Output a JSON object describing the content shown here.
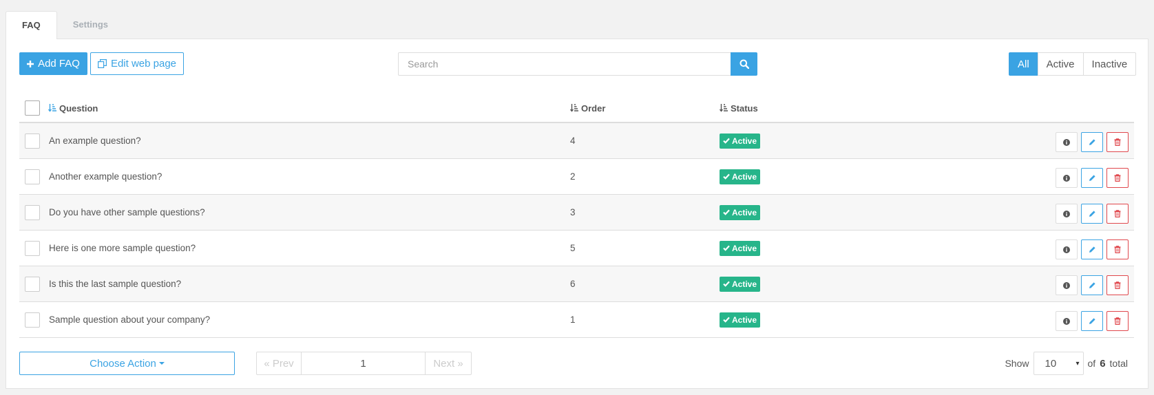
{
  "tabs": [
    {
      "label": "FAQ",
      "active": true
    },
    {
      "label": "Settings",
      "active": false
    }
  ],
  "toolbar": {
    "add_label": "Add FAQ",
    "edit_label": "Edit web page"
  },
  "search": {
    "placeholder": "Search",
    "value": ""
  },
  "filters": [
    {
      "label": "All",
      "active": true
    },
    {
      "label": "Active",
      "active": false
    },
    {
      "label": "Inactive",
      "active": false
    }
  ],
  "table": {
    "columns": {
      "question": "Question",
      "order": "Order",
      "status": "Status"
    },
    "rows": [
      {
        "question": "An example question?",
        "order": "4",
        "status": "Active"
      },
      {
        "question": "Another example question?",
        "order": "2",
        "status": "Active"
      },
      {
        "question": "Do you have other sample questions?",
        "order": "3",
        "status": "Active"
      },
      {
        "question": "Here is one more sample question?",
        "order": "5",
        "status": "Active"
      },
      {
        "question": "Is this the last sample question?",
        "order": "6",
        "status": "Active"
      },
      {
        "question": "Sample question about your company?",
        "order": "1",
        "status": "Active"
      }
    ]
  },
  "footer": {
    "choose_action": "Choose Action",
    "prev": "« Prev",
    "page": "1",
    "next": "Next »",
    "show_label": "Show",
    "page_size": "10",
    "of_label": "of",
    "total": "6",
    "total_label": "total"
  },
  "colors": {
    "accent": "#3aa3e3",
    "success": "#27b58a",
    "danger": "#e0474c"
  },
  "icons": [
    "plus-icon",
    "copy-icon",
    "search-icon",
    "sort-icon",
    "check-icon",
    "info-icon",
    "pencil-icon",
    "trash-icon"
  ]
}
